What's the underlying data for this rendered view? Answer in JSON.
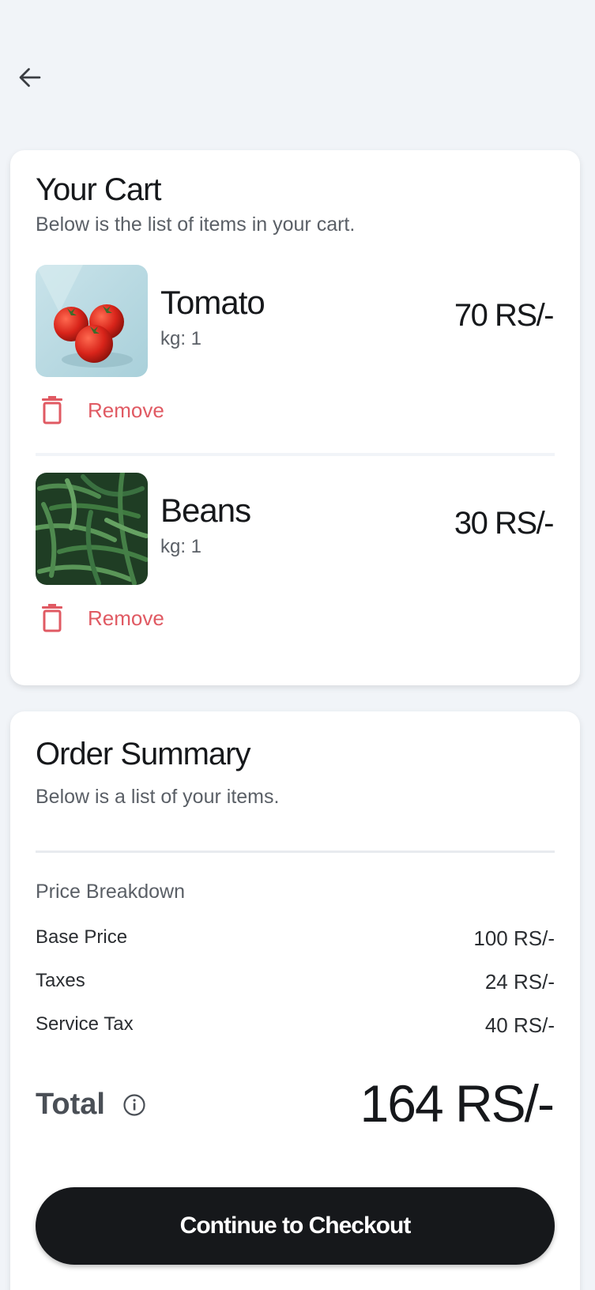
{
  "cart": {
    "title": "Your Cart",
    "subtitle": "Below is the list of items in your cart.",
    "items": [
      {
        "name": "Tomato",
        "qty": "kg: 1",
        "price": "70 RS/-",
        "remove_label": "Remove",
        "image": "tomato-photo"
      },
      {
        "name": "Beans",
        "qty": "kg: 1",
        "price": "30 RS/-",
        "remove_label": "Remove",
        "image": "beans-photo"
      }
    ]
  },
  "summary": {
    "title": "Order Summary",
    "subtitle": "Below is a list of your items.",
    "breakdown_title": "Price Breakdown",
    "rows": [
      {
        "label": "Base Price",
        "value": "100 RS/-"
      },
      {
        "label": "Taxes",
        "value": "24 RS/-"
      },
      {
        "label": "Service Tax",
        "value": "40 RS/-"
      }
    ],
    "total_label": "Total",
    "total_value": "164 RS/-",
    "checkout_label": "Continue to Checkout"
  },
  "icons": {
    "back": "arrow-left-icon",
    "remove": "trash-icon",
    "info": "info-icon"
  },
  "colors": {
    "background": "#f1f4f8",
    "accent_remove": "#e05a63",
    "button": "#16181b"
  }
}
